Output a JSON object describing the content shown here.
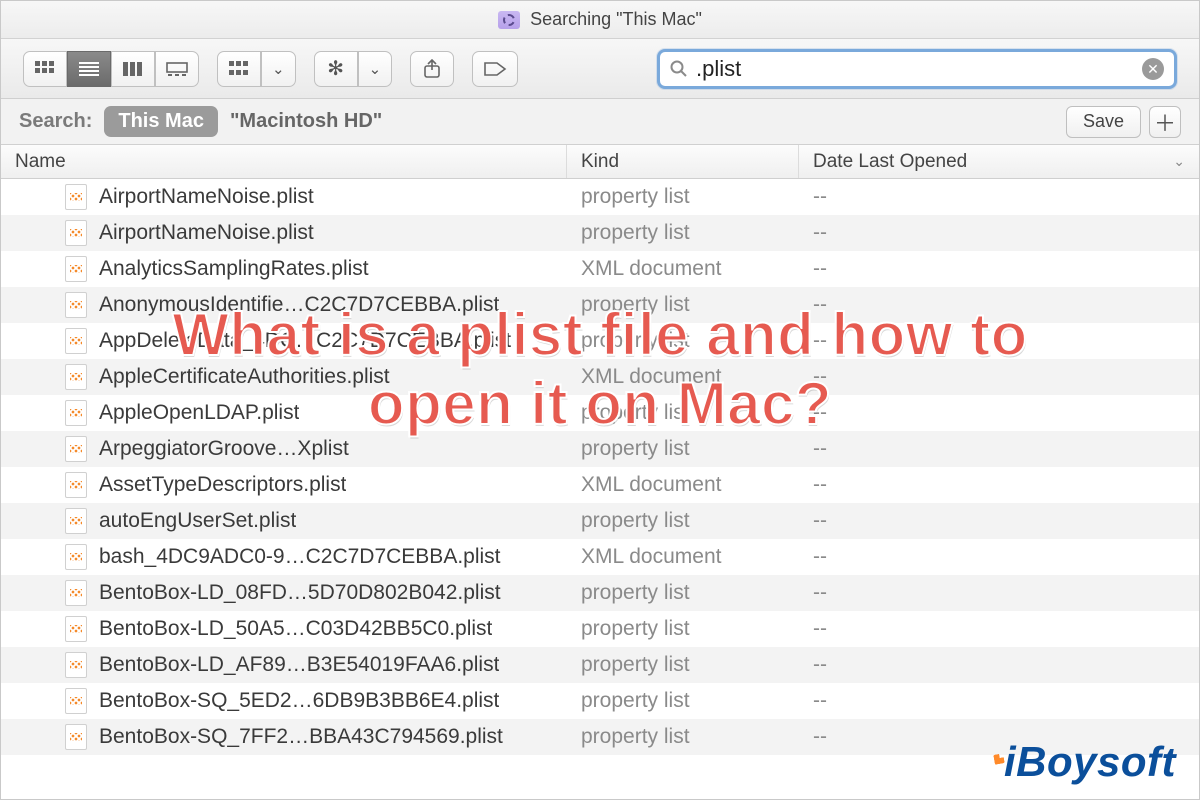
{
  "window": {
    "title": "Searching \"This Mac\""
  },
  "toolbar": {
    "view_icon": "icon-view",
    "view_list": "list-view",
    "view_columns": "column-view",
    "view_gallery": "gallery-view",
    "group_by": "group-by",
    "action": "action-menu",
    "share": "share",
    "tags": "tags"
  },
  "search": {
    "query": ".plist",
    "placeholder": "Search"
  },
  "scope": {
    "label": "Search:",
    "this_mac": "This Mac",
    "macintosh_hd": "\"Macintosh HD\"",
    "save": "Save"
  },
  "columns": {
    "name": "Name",
    "kind": "Kind",
    "date": "Date Last Opened"
  },
  "files": [
    {
      "name": "AirportNameNoise.plist",
      "kind": "property list",
      "date": "--"
    },
    {
      "name": "AirportNameNoise.plist",
      "kind": "property list",
      "date": "--"
    },
    {
      "name": "AnalyticsSamplingRates.plist",
      "kind": "XML document",
      "date": "--"
    },
    {
      "name": "AnonymousIdentifie…C2C7D7CEBBA.plist",
      "kind": "property list",
      "date": "--"
    },
    {
      "name": "AppDeleteData_4DC…C2C7D7CEBBA.plist",
      "kind": "property list",
      "date": "--"
    },
    {
      "name": "AppleCertificateAuthorities.plist",
      "kind": "XML document",
      "date": "--"
    },
    {
      "name": "AppleOpenLDAP.plist",
      "kind": "property list",
      "date": "--"
    },
    {
      "name": "ArpeggiatorGroove…Xplist",
      "kind": "property list",
      "date": "--"
    },
    {
      "name": "AssetTypeDescriptors.plist",
      "kind": "XML document",
      "date": "--"
    },
    {
      "name": "autoEngUserSet.plist",
      "kind": "property list",
      "date": "--"
    },
    {
      "name": "bash_4DC9ADC0-9…C2C7D7CEBBA.plist",
      "kind": "XML document",
      "date": "--"
    },
    {
      "name": "BentoBox-LD_08FD…5D70D802B042.plist",
      "kind": "property list",
      "date": "--"
    },
    {
      "name": "BentoBox-LD_50A5…C03D42BB5C0.plist",
      "kind": "property list",
      "date": "--"
    },
    {
      "name": "BentoBox-LD_AF89…B3E54019FAA6.plist",
      "kind": "property list",
      "date": "--"
    },
    {
      "name": "BentoBox-SQ_5ED2…6DB9B3BB6E4.plist",
      "kind": "property list",
      "date": "--"
    },
    {
      "name": "BentoBox-SQ_7FF2…BBA43C794569.plist",
      "kind": "property list",
      "date": "--"
    }
  ],
  "overlay": {
    "line1": "What is a plist file and how to",
    "line2": "open it on Mac?"
  },
  "watermark": {
    "text": "iBoysoft"
  }
}
